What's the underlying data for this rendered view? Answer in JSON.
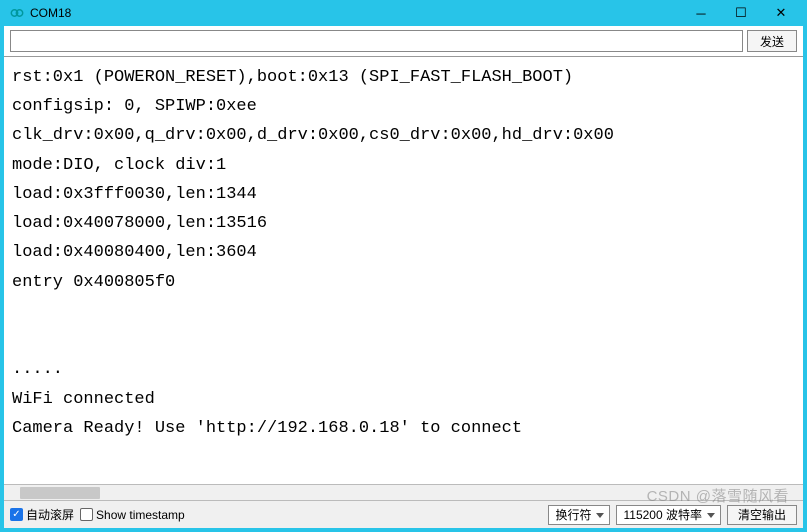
{
  "titlebar": {
    "title": "COM18"
  },
  "input_row": {
    "value": "",
    "send_label": "发送"
  },
  "console_lines": [
    "rst:0x1 (POWERON_RESET),boot:0x13 (SPI_FAST_FLASH_BOOT)",
    "configsip: 0, SPIWP:0xee",
    "clk_drv:0x00,q_drv:0x00,d_drv:0x00,cs0_drv:0x00,hd_drv:0x00",
    "mode:DIO, clock div:1",
    "load:0x3fff0030,len:1344",
    "load:0x40078000,len:13516",
    "load:0x40080400,len:3604",
    "entry 0x400805f0",
    "",
    "",
    ".....",
    "WiFi connected",
    "Camera Ready! Use 'http://192.168.0.18' to connect"
  ],
  "bottombar": {
    "autoscroll_label": "自动滚屏",
    "timestamp_label": "Show timestamp",
    "line_ending": "换行符",
    "baud": "115200 波特率",
    "clear_label": "清空输出"
  },
  "watermark": "CSDN @落雪随风看"
}
